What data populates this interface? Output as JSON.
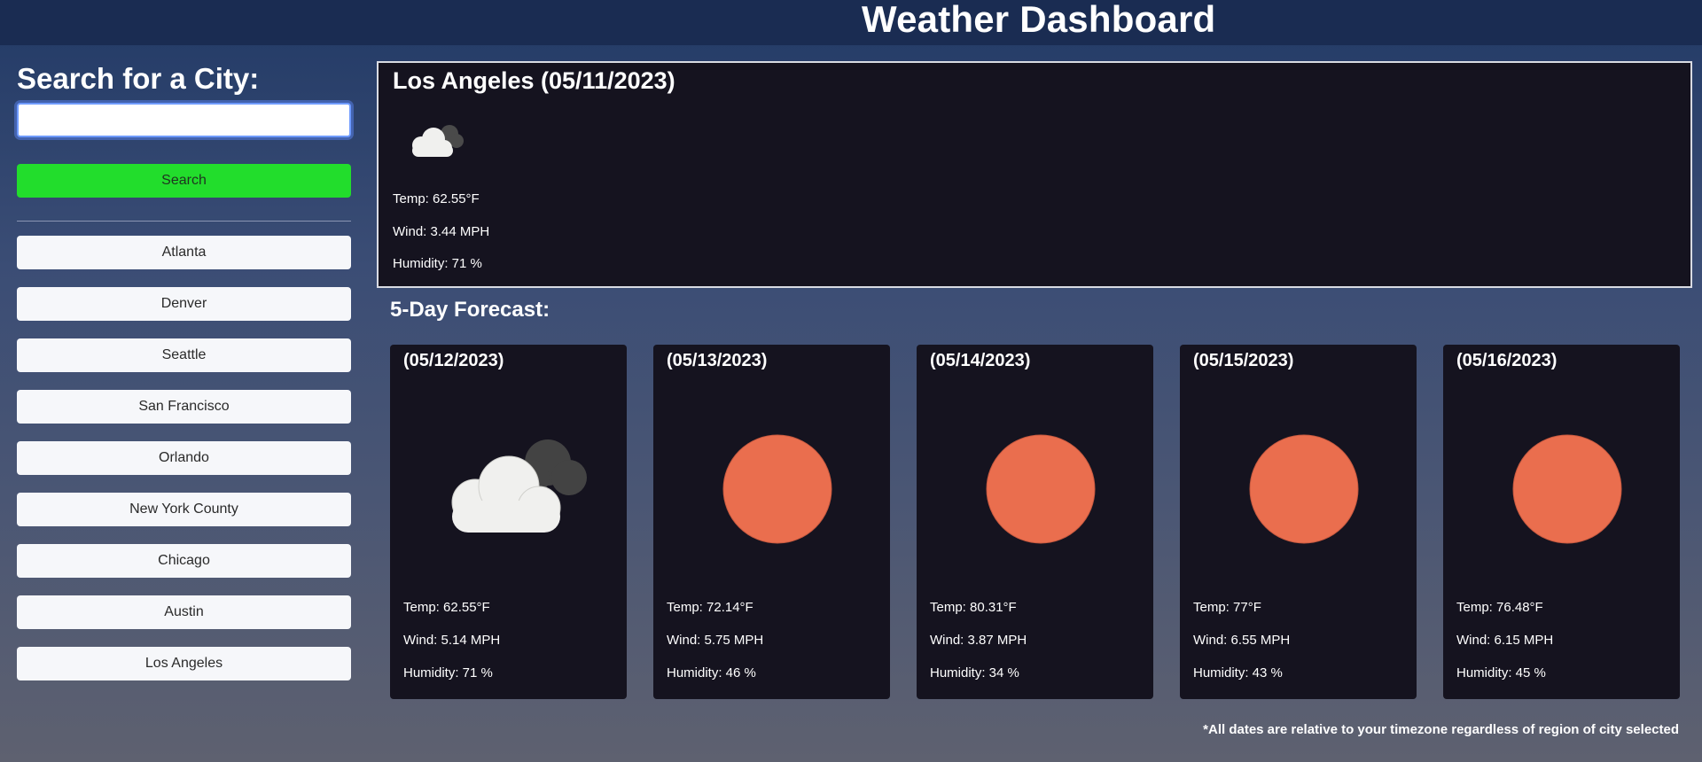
{
  "header": {
    "title": "Weather Dashboard"
  },
  "sidebar": {
    "heading": "Search for a City:",
    "search_value": "",
    "search_button": "Search",
    "cities": [
      "Atlanta",
      "Denver",
      "Seattle",
      "San Francisco",
      "Orlando",
      "New York County",
      "Chicago",
      "Austin",
      "Los Angeles"
    ]
  },
  "current": {
    "title": "Los Angeles (05/11/2023)",
    "icon": "cloudy-icon",
    "temp": "Temp: 62.55°F",
    "wind": "Wind: 3.44 MPH",
    "humidity": "Humidity: 71 %"
  },
  "forecast": {
    "heading": "5-Day Forecast:",
    "days": [
      {
        "date": "(05/12/2023)",
        "icon": "cloudy-icon",
        "temp": "Temp: 62.55°F",
        "wind": "Wind: 5.14 MPH",
        "humidity": "Humidity: 71 %"
      },
      {
        "date": "(05/13/2023)",
        "icon": "sun-icon",
        "temp": "Temp: 72.14°F",
        "wind": "Wind: 5.75 MPH",
        "humidity": "Humidity: 46 %"
      },
      {
        "date": "(05/14/2023)",
        "icon": "sun-icon",
        "temp": "Temp: 80.31°F",
        "wind": "Wind: 3.87 MPH",
        "humidity": "Humidity: 34 %"
      },
      {
        "date": "(05/15/2023)",
        "icon": "sun-icon",
        "temp": "Temp: 77°F",
        "wind": "Wind: 6.55 MPH",
        "humidity": "Humidity: 43 %"
      },
      {
        "date": "(05/16/2023)",
        "icon": "sun-icon",
        "temp": "Temp: 76.48°F",
        "wind": "Wind: 6.15 MPH",
        "humidity": "Humidity: 45 %"
      }
    ]
  },
  "footnote": "*All dates are relative to your timezone regardless of region of city selected",
  "colors": {
    "search_button": "#22dd2c",
    "sun": "#ea6e4e",
    "card_bg": "#15131f"
  }
}
